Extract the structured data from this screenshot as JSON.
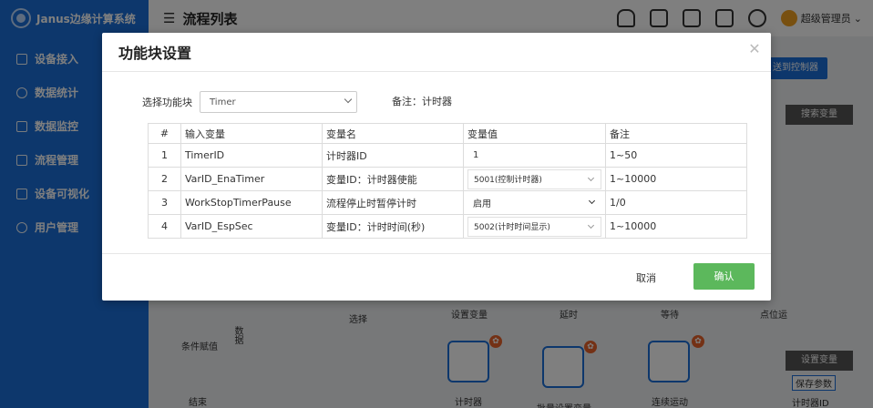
{
  "app": {
    "brand": "Janus边缘计算系统",
    "page_title": "流程列表",
    "user": "超级管理员"
  },
  "sidebar": {
    "items": [
      {
        "label": "设备接入",
        "icon": "device-icon"
      },
      {
        "label": "数据统计",
        "icon": "clock-icon"
      },
      {
        "label": "数据监控",
        "icon": "monitor-icon"
      },
      {
        "label": "流程管理",
        "icon": "flow-icon"
      },
      {
        "label": "设备可视化",
        "icon": "visual-icon"
      },
      {
        "label": "用户管理",
        "icon": "user-icon"
      }
    ]
  },
  "topbar": {
    "icons": [
      "bell-icon",
      "grid-icon",
      "api-icon",
      "signal-icon",
      "cloud-icon"
    ]
  },
  "background": {
    "send_button": "送到控制器",
    "search_var_header": "搜索变量",
    "set_var_header": "设置变量",
    "save_params": "保存参数",
    "timer_id_label": "计时器ID",
    "tool_labels": [
      "选择",
      "设置变量",
      "延时",
      "等待",
      "点位运"
    ],
    "tool_labels_row2": [
      "条件赋值",
      "结束",
      "计时器",
      "批量设置变量",
      "连续运动"
    ],
    "side_tab": "数据"
  },
  "modal": {
    "title": "功能块设置",
    "select_label": "选择功能块",
    "selected_block": "Timer",
    "remark": "备注：计时器",
    "table": {
      "headers": [
        "#",
        "输入变量",
        "变量名",
        "变量值",
        "备注"
      ],
      "rows": [
        {
          "num": "1",
          "input_var": "TimerID",
          "var_name": "计时器ID",
          "value": "1",
          "note": "1~50"
        },
        {
          "num": "2",
          "input_var": "VarID_EnaTimer",
          "var_name": "变量ID：计时器使能",
          "value": "5001(控制计时器)",
          "note": "1~10000"
        },
        {
          "num": "3",
          "input_var": "WorkStopTimerPause",
          "var_name": "流程停止时暂停计时",
          "value": "启用",
          "note": "1/0"
        },
        {
          "num": "4",
          "input_var": "VarID_EspSec",
          "var_name": "变量ID：计时时间(秒)",
          "value": "5002(计时时间显示)",
          "note": "1~10000"
        }
      ]
    },
    "cancel": "取消",
    "confirm": "确认"
  }
}
